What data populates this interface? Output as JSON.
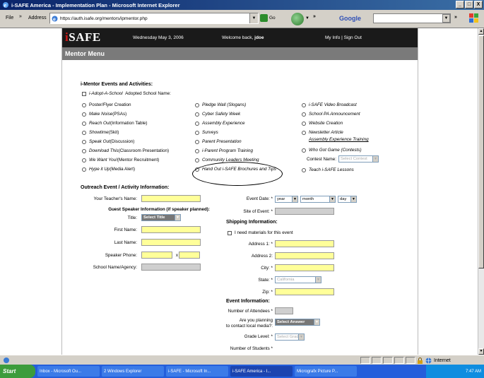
{
  "window": {
    "title": "i-SAFE America - Implementation Plan - Microsoft Internet Explorer",
    "controls": [
      "_",
      "□",
      "X"
    ]
  },
  "toolbar": {
    "file": "File",
    "more": "»",
    "address_label": "Address",
    "url": "https://auth.isafe.org/mentors/ipmentor.php",
    "go": "Go",
    "google": "Google",
    "more2": "»"
  },
  "site": {
    "logo_i": "i",
    "logo_rest": "SAFE",
    "date": "Wednesday May 3, 2006",
    "welcome_prefix": "Welcome back,",
    "user": "jdoe",
    "links": "My Info | Sign Out",
    "menu_title": "Mentor Menu"
  },
  "events": {
    "title": "i-Mentor Events and Activities:",
    "adopt_label": "i-Adopt-A-School",
    "adopt_name_label": "Adopted School Name:",
    "col1": [
      {
        "em": "",
        "text": "Poster/Flyer Creation"
      },
      {
        "em": "Make Noise",
        "text": " (PSAs)"
      },
      {
        "em": "Reach Out",
        "text": " (Information Table)"
      },
      {
        "em": "Showtime",
        "text": " (Skit)"
      },
      {
        "em": "Speak Out",
        "text": " (Discussion)"
      },
      {
        "em": "Download This",
        "text": " (Classroom Presentation)"
      },
      {
        "em": "We Want You!",
        "text": " (Mentor Recruitment)"
      },
      {
        "em": "Hype it Up",
        "text": " (Media Alert)"
      }
    ],
    "col2": [
      "Pledge Wall (Slogans)",
      "Cyber Safety Week",
      "Assembly Experience",
      "Surveys",
      "Parent Presentation",
      "i-Parent Program Training",
      "Community Leaders Meeting",
      "Hand Out i-SAFE Brochures and Tips"
    ],
    "col3": [
      "i-SAFE Video Broadcast",
      "School PA Announcement",
      "Website Creation",
      "Newsletter Article"
    ],
    "assembly_link": "Assembly Experience Training",
    "who_got_game": "Who Got Game (Contests)",
    "contest_name_label": "Contest Name:",
    "contest_select": "Select Contest",
    "teach": "Teach i-SAFE Lessons"
  },
  "outreach": {
    "title": "Outreach Event / Activity Information:",
    "teacher_name": "Your Teacher's Name:",
    "guest_title": "Guest Speaker Information (if speaker planned):",
    "title_label": "Title:",
    "title_select": "Select Title",
    "first_name": "First Name:",
    "last_name": "Last Name:",
    "phone": "Speaker Phone:",
    "phone_x": "x",
    "school": "School Name/Agency:",
    "event_date": "Event Date: *",
    "year": "year",
    "month": "month",
    "day": "day",
    "site": "Site of Event: *"
  },
  "shipping": {
    "title": "Shipping Information:",
    "need_materials": "I need materials for this event",
    "address1": "Address 1: *",
    "address2": "Address 2:",
    "city": "City: *",
    "state": "State: *",
    "state_value": "California",
    "zip": "Zip: *"
  },
  "event_info": {
    "title": "Event Information:",
    "attendees": "Number of Attendees *",
    "planning_line1": "Are you planning",
    "planning_line2": "to contact local media?:",
    "answer_select": "Select Answer",
    "grade": "Grade Level: *",
    "grade_select": "Select Grade",
    "students": "Number of Students *"
  },
  "status": {
    "zone": "Internet"
  },
  "taskbar": {
    "start": "Start",
    "tasks": [
      "Inbox - Microsoft Ou...",
      "2 Windows Explorer",
      "i-SAFE - Microsoft In...",
      "i-SAFE America - I...",
      "Micrografx Picture P..."
    ],
    "time": "7:47 AM"
  },
  "colors": {
    "title_bar": "#0a246a",
    "required_field": "#ffff99",
    "header": "#1a1a1a",
    "logo_accent": "#d01818"
  }
}
